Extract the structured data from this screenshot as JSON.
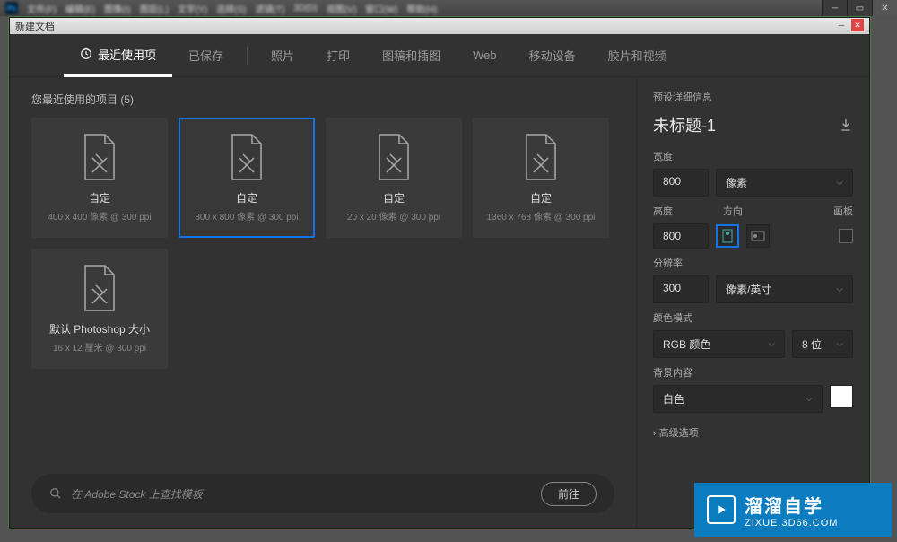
{
  "app": {
    "menus": [
      "文件(F)",
      "编辑(E)",
      "图像(I)",
      "图层(L)",
      "文字(Y)",
      "选择(S)",
      "滤镜(T)",
      "3D(D)",
      "视图(V)",
      "窗口(W)",
      "帮助(H)"
    ]
  },
  "dialog": {
    "title": "新建文档"
  },
  "tabs": {
    "recent": "最近使用项",
    "saved": "已保存",
    "photo": "照片",
    "print": "打印",
    "art": "图稿和插图",
    "web": "Web",
    "mobile": "移动设备",
    "film": "胶片和视频"
  },
  "section": {
    "title": "您最近使用的项目",
    "count": "(5)"
  },
  "presets": [
    {
      "name": "自定",
      "spec": "400 x 400 像素 @ 300 ppi"
    },
    {
      "name": "自定",
      "spec": "800 x 800 像素 @ 300 ppi"
    },
    {
      "name": "自定",
      "spec": "20 x 20 像素 @ 300 ppi"
    },
    {
      "name": "自定",
      "spec": "1360 x 768 像素 @ 300 ppi"
    },
    {
      "name": "默认 Photoshop 大小",
      "spec": "16 x 12 厘米 @ 300 ppi"
    }
  ],
  "search": {
    "placeholder": "在 Adobe Stock 上查找模板",
    "go": "前往"
  },
  "details": {
    "header": "预设详细信息",
    "doc_title": "未标题-1",
    "width_label": "宽度",
    "width_value": "800",
    "width_unit": "像素",
    "height_label": "高度",
    "height_value": "800",
    "orient_label": "方向",
    "artboard_label": "画板",
    "res_label": "分辨率",
    "res_value": "300",
    "res_unit": "像素/英寸",
    "color_label": "颜色模式",
    "color_mode": "RGB 颜色",
    "color_depth": "8 位",
    "bg_label": "背景内容",
    "bg_value": "白色",
    "advanced": "高级选项"
  },
  "watermark": {
    "cn": "溜溜自学",
    "url": "ZIXUE.3D66.COM"
  }
}
